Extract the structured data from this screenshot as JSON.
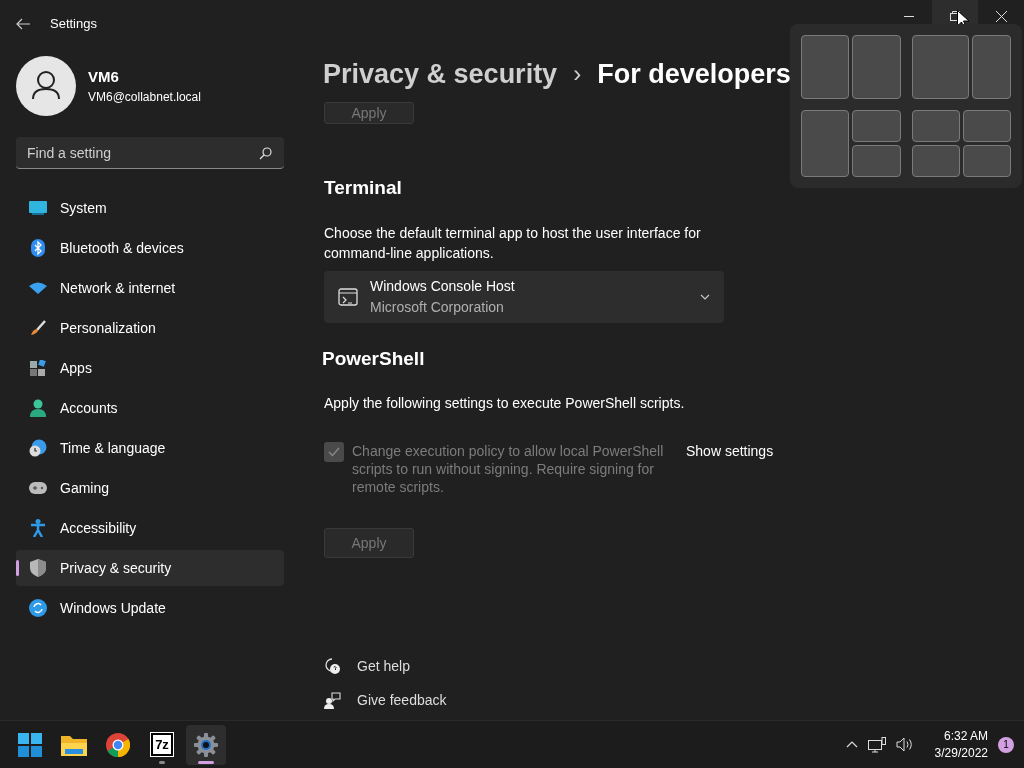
{
  "window": {
    "title": "Settings"
  },
  "user": {
    "name": "VM6",
    "email": "VM6@collabnet.local"
  },
  "search": {
    "placeholder": "Find a setting"
  },
  "nav": [
    {
      "label": "System",
      "kind": "system",
      "selected": false
    },
    {
      "label": "Bluetooth & devices",
      "kind": "bluetooth",
      "selected": false
    },
    {
      "label": "Network & internet",
      "kind": "network",
      "selected": false
    },
    {
      "label": "Personalization",
      "kind": "brush",
      "selected": false
    },
    {
      "label": "Apps",
      "kind": "apps",
      "selected": false
    },
    {
      "label": "Accounts",
      "kind": "accounts",
      "selected": false
    },
    {
      "label": "Time & language",
      "kind": "time",
      "selected": false
    },
    {
      "label": "Gaming",
      "kind": "gaming",
      "selected": false
    },
    {
      "label": "Accessibility",
      "kind": "accessibility",
      "selected": false
    },
    {
      "label": "Privacy & security",
      "kind": "privacy",
      "selected": true
    },
    {
      "label": "Windows Update",
      "kind": "update",
      "selected": false
    }
  ],
  "breadcrumb": {
    "parent": "Privacy & security",
    "separator": "›",
    "current": "For developers"
  },
  "top_apply": {
    "label": "Apply",
    "disabled": true
  },
  "terminal": {
    "heading": "Terminal",
    "description": "Choose the default terminal app to host the user interface for command-line applications.",
    "dropdown": {
      "value": "Windows Console Host",
      "subtitle": "Microsoft Corporation"
    }
  },
  "powershell": {
    "heading": "PowerShell",
    "description": "Apply the following settings to execute PowerShell scripts.",
    "checkbox": {
      "label": "Change execution policy to allow local PowerShell scripts to run without signing. Require signing for remote scripts.",
      "checked": true,
      "disabled": true
    },
    "link": "Show settings",
    "apply": {
      "label": "Apply",
      "disabled": true
    }
  },
  "help_links": [
    {
      "label": "Get help",
      "kind": "help"
    },
    {
      "label": "Give feedback",
      "kind": "feedback"
    }
  ],
  "taskbar": {
    "apps": [
      {
        "kind": "start",
        "running": false,
        "active": false
      },
      {
        "kind": "explorer",
        "running": false,
        "active": false
      },
      {
        "kind": "chrome",
        "running": false,
        "active": false
      },
      {
        "kind": "sevenzip",
        "label": "7z",
        "running": true,
        "active": false
      },
      {
        "kind": "settings",
        "running": true,
        "active": true
      }
    ],
    "time": "6:32 AM",
    "date": "3/29/2022",
    "notifications": "1"
  }
}
